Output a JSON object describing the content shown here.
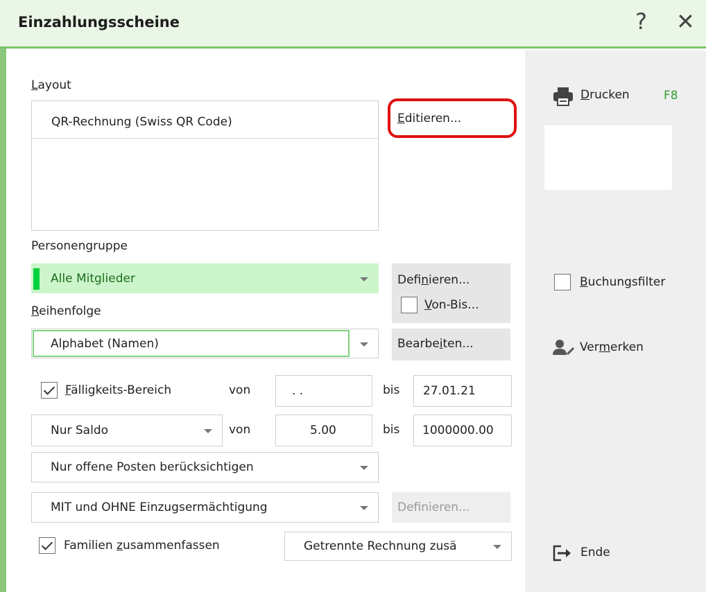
{
  "window": {
    "title": "Einzahlungsscheine",
    "help_glyph": "?",
    "close_glyph": "✕"
  },
  "layout": {
    "label_first": "L",
    "label_rest": "ayout",
    "items": [
      "QR-Rechnung (Swiss QR Code)"
    ],
    "edit_prefix": "",
    "edit_mnemonic": "E",
    "edit_rest": "ditieren..."
  },
  "personengruppe": {
    "label": "Personengruppe",
    "selected": "Alle Mitglieder",
    "define_prefix": "Defi",
    "define_mnemonic": "n",
    "define_rest": "ieren...",
    "vonbis_mnemonic": "V",
    "vonbis_rest": "on-Bis..."
  },
  "reihenfolge": {
    "label_mnemonic": "R",
    "label_rest": "eihenfolge",
    "selected": "Alphabet (Namen)",
    "edit_prefix": "Bearbe",
    "edit_mnemonic": "i",
    "edit_rest": "ten..."
  },
  "faelligkeit": {
    "checked": true,
    "label_mnemonic": "F",
    "label_rest": "älligkeits-Bereich",
    "von_label": "von",
    "von_value": ". .",
    "bis_label": "bis",
    "bis_value": "27.01.21"
  },
  "saldo": {
    "selected": "Nur Saldo",
    "von_label": "von",
    "von_value": "5.00",
    "bis_label": "bis",
    "bis_value": "1000000.00"
  },
  "posten": {
    "selected": "Nur offene Posten berücksichtigen"
  },
  "einzug": {
    "selected": "MIT und OHNE Einzugsermächtigung",
    "define_label": "Definieren..."
  },
  "familien": {
    "checked": true,
    "label_prefix": "Familien ",
    "label_mnemonic": "z",
    "label_rest": "usammenfassen",
    "option": "Getrennte Rechnung zusä"
  },
  "sidebar": {
    "print_mnemonic": "D",
    "print_rest": "rucken",
    "print_shortcut": "F8",
    "filter_mnemonic": "B",
    "filter_rest": "uchungsfilter",
    "notes_prefix": "Ver",
    "notes_mnemonic": "m",
    "notes_rest": "erken",
    "end_label": "Ende"
  },
  "colors": {
    "title_bg": "#eaf6e6",
    "accent_green": "#7ec46a",
    "selection_green": "#ccf5cc",
    "selection_marker": "#00d23c",
    "shortcut_green": "#2e9e2e",
    "highlight_red": "#e01010"
  }
}
